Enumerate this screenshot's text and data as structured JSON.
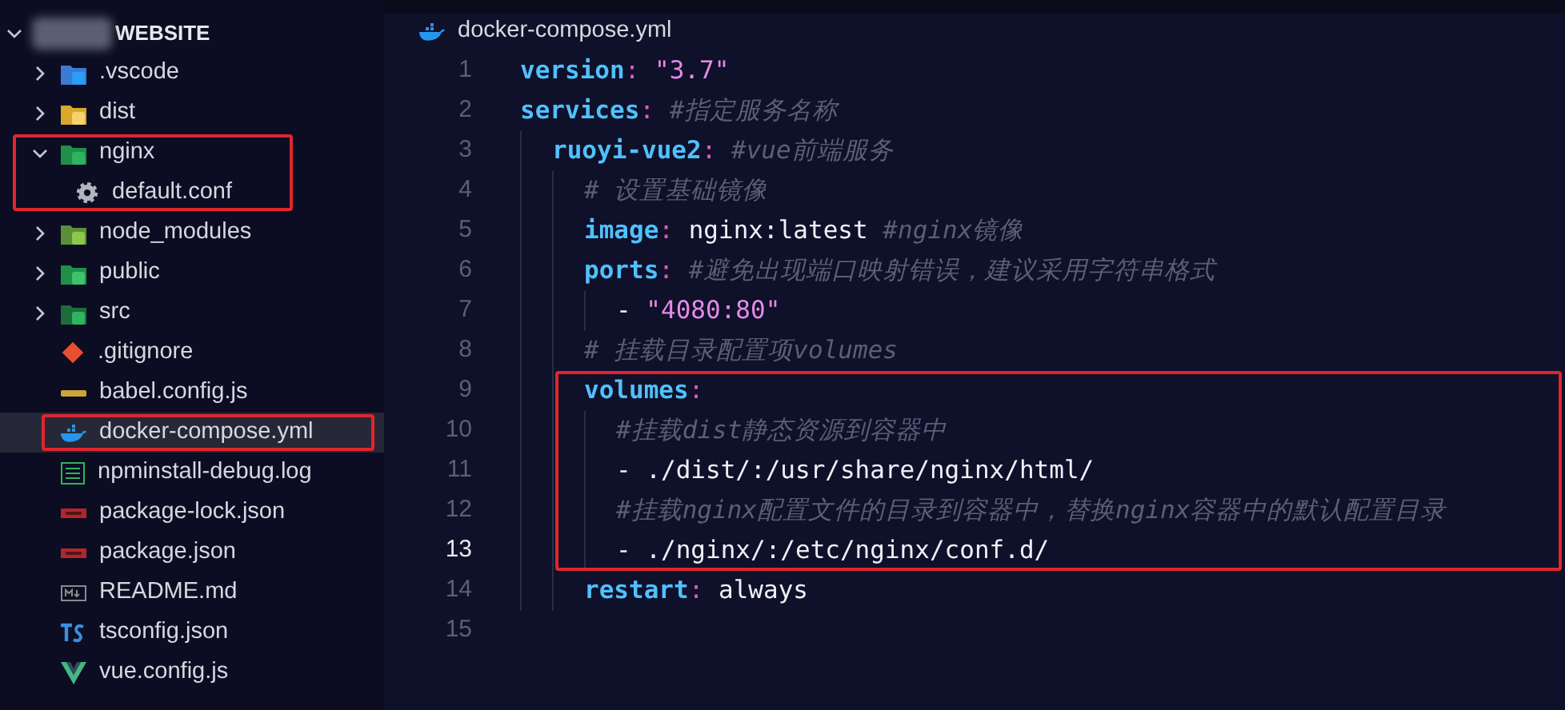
{
  "explorer": {
    "root": {
      "label": "WEBSITE",
      "expanded": true
    },
    "items": [
      {
        "label": ".vscode",
        "kind": "vscode",
        "expanded": false,
        "selected": false,
        "boxed": false
      },
      {
        "label": "dist",
        "kind": "dist",
        "expanded": false,
        "selected": false,
        "boxed": false
      },
      {
        "label": "nginx",
        "kind": "nginx",
        "expanded": true,
        "selected": false,
        "boxed": true,
        "children": [
          {
            "label": "default.conf",
            "kind": "gear",
            "selected": false,
            "boxed": false
          }
        ]
      },
      {
        "label": "node_modules",
        "kind": "nodemodules",
        "expanded": false,
        "selected": false,
        "boxed": false
      },
      {
        "label": "public",
        "kind": "public",
        "expanded": false,
        "selected": false,
        "boxed": false
      },
      {
        "label": "src",
        "kind": "src",
        "expanded": false,
        "selected": false,
        "boxed": false
      },
      {
        "label": ".gitignore",
        "kind": "git",
        "selected": false,
        "boxed": false
      },
      {
        "label": "babel.config.js",
        "kind": "babel",
        "selected": false,
        "boxed": false
      },
      {
        "label": "docker-compose.yml",
        "kind": "docker",
        "selected": true,
        "boxed": true
      },
      {
        "label": "npminstall-debug.log",
        "kind": "log",
        "selected": false,
        "boxed": false
      },
      {
        "label": "package-lock.json",
        "kind": "npm",
        "selected": false,
        "boxed": false
      },
      {
        "label": "package.json",
        "kind": "npm",
        "selected": false,
        "boxed": false
      },
      {
        "label": "README.md",
        "kind": "markdown",
        "selected": false,
        "boxed": false
      },
      {
        "label": "tsconfig.json",
        "kind": "typescript",
        "selected": false,
        "boxed": false
      },
      {
        "label": "vue.config.js",
        "kind": "vue",
        "selected": false,
        "boxed": false
      }
    ]
  },
  "editor": {
    "tab": {
      "label": "docker-compose.yml",
      "kind": "docker"
    },
    "lines": [
      {
        "number": "1",
        "selected": false,
        "boxed": false,
        "tokens": [
          {
            "kind": "key",
            "text": "version"
          },
          {
            "kind": "punct",
            "text": ": "
          },
          {
            "kind": "string",
            "text": "\"3.7\""
          }
        ]
      },
      {
        "number": "2",
        "selected": false,
        "boxed": false,
        "tokens": [
          {
            "kind": "key",
            "text": "services"
          },
          {
            "kind": "punct",
            "text": ": "
          },
          {
            "kind": "comment",
            "text": "#指定服务名称"
          }
        ],
        "children": [
          {
            "number": "3",
            "selected": false,
            "boxed": false,
            "tokens": [
              {
                "kind": "key",
                "text": "ruoyi-vue2"
              },
              {
                "kind": "punct",
                "text": ": "
              },
              {
                "kind": "comment",
                "text": "#vue前端服务"
              }
            ],
            "children": [
              {
                "number": "4",
                "selected": false,
                "boxed": false,
                "tokens": [
                  {
                    "kind": "comment",
                    "text": "# 设置基础镜像"
                  }
                ]
              },
              {
                "number": "5",
                "selected": false,
                "boxed": false,
                "tokens": [
                  {
                    "kind": "key",
                    "text": "image"
                  },
                  {
                    "kind": "punct",
                    "text": ": "
                  },
                  {
                    "kind": "plain",
                    "text": "nginx:latest "
                  },
                  {
                    "kind": "comment",
                    "text": "#nginx镜像"
                  }
                ]
              },
              {
                "number": "6",
                "selected": false,
                "boxed": false,
                "tokens": [
                  {
                    "kind": "key",
                    "text": "ports"
                  },
                  {
                    "kind": "punct",
                    "text": ": "
                  },
                  {
                    "kind": "comment",
                    "text": "#避免出现端口映射错误，建议采用字符串格式"
                  }
                ],
                "children": [
                  {
                    "number": "7",
                    "selected": false,
                    "boxed": false,
                    "tokens": [
                      {
                        "kind": "plain",
                        "text": "- "
                      },
                      {
                        "kind": "string",
                        "text": "\"4080:80\""
                      }
                    ]
                  }
                ]
              },
              {
                "number": "8",
                "selected": false,
                "boxed": false,
                "tokens": [
                  {
                    "kind": "comment",
                    "text": "# 挂载目录配置项volumes"
                  }
                ]
              },
              {
                "number": "9",
                "selected": false,
                "boxed": true,
                "tokens": [
                  {
                    "kind": "key",
                    "text": "volumes"
                  },
                  {
                    "kind": "punct",
                    "text": ":"
                  }
                ],
                "children": [
                  {
                    "number": "10",
                    "selected": false,
                    "tokens": [
                      {
                        "kind": "comment",
                        "text": "#挂载dist静态资源到容器中"
                      }
                    ]
                  },
                  {
                    "number": "11",
                    "selected": false,
                    "tokens": [
                      {
                        "kind": "plain",
                        "text": "- ./dist/:/usr/share/nginx/html/"
                      }
                    ]
                  },
                  {
                    "number": "12",
                    "selected": false,
                    "tokens": [
                      {
                        "kind": "comment",
                        "text": "#挂载nginx配置文件的目录到容器中，替换nginx容器中的默认配置目录"
                      }
                    ]
                  },
                  {
                    "number": "13",
                    "selected": true,
                    "tokens": [
                      {
                        "kind": "plain",
                        "text": "- ./nginx/:/etc/nginx/conf.d/"
                      }
                    ]
                  }
                ]
              },
              {
                "number": "14",
                "selected": false,
                "boxed": false,
                "tokens": [
                  {
                    "kind": "key",
                    "text": "restart"
                  },
                  {
                    "kind": "punct",
                    "text": ": "
                  },
                  {
                    "kind": "plain",
                    "text": "always"
                  }
                ]
              }
            ]
          }
        ]
      },
      {
        "number": "15",
        "selected": false,
        "boxed": false
      }
    ]
  }
}
